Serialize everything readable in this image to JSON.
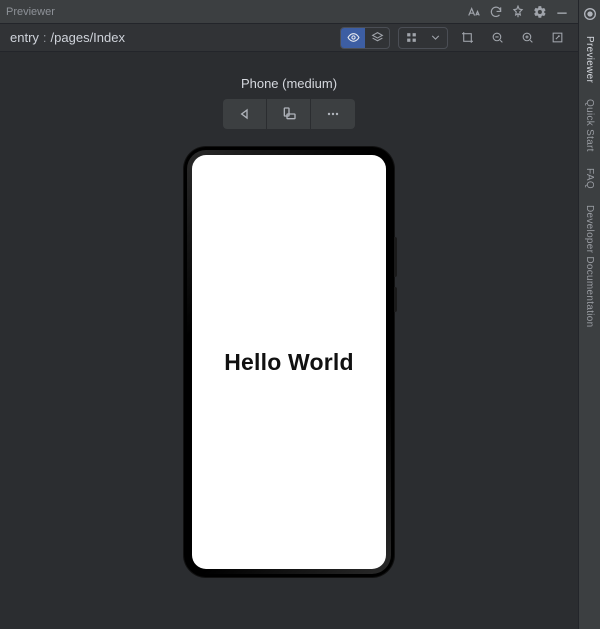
{
  "titleBar": {
    "title": "Previewer"
  },
  "header": {
    "module": "entry",
    "colon": ":",
    "path": "/pages/Index"
  },
  "deviceLabel": "Phone (medium)",
  "screenText": "Hello World",
  "sideTabs": {
    "previewer": "Previewer",
    "quickStart": "Quick Start",
    "faq": "FAQ",
    "devDoc": "Developer Documentation"
  },
  "colors": {
    "bg": "#2b2d30",
    "panel": "#3c3f41",
    "active": "#3d5ea3"
  }
}
